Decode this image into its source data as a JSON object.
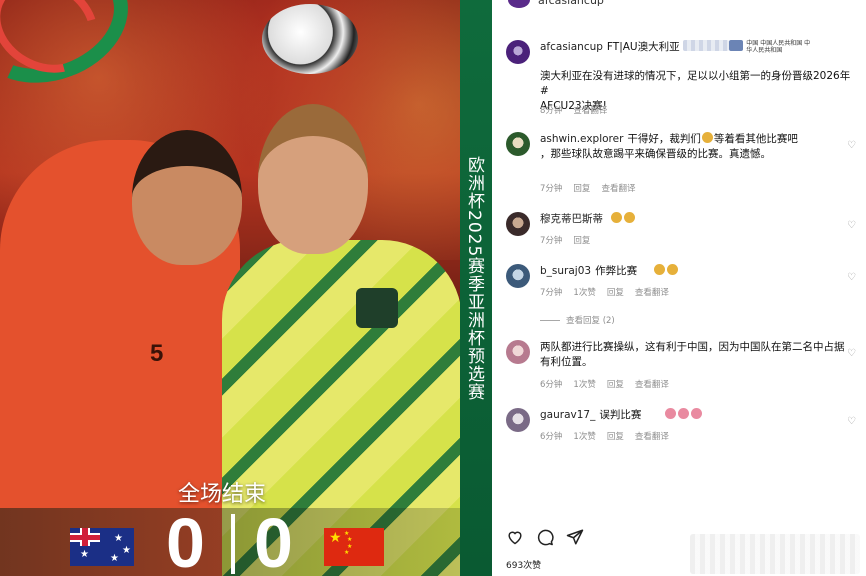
{
  "post_image": {
    "vertical_title": "欧洲杯2025赛季亚洲杯预选赛",
    "fulltime_label": "全场结束",
    "score_home": "0",
    "score_away": "0",
    "home_flag": "australia-flag",
    "away_flag": "china-flag",
    "jersey_number": "5"
  },
  "header": {
    "account": "afcasiancup"
  },
  "comments": [
    {
      "user": "afcasiancup",
      "text_line1": "FT|AU澳大利亚",
      "tag_text": "中国 中国人民共和国 中",
      "tag_text2": "华人民共和国",
      "text_line2": "澳大利亚在没有进球的情况下，足以以小组第一的身份晋级2026年#",
      "text_line3": "AFCU23决赛!",
      "time": "8分钟",
      "see_translation": "查看翻译"
    },
    {
      "user": "ashwin.explorer",
      "text_line1": "干得好，裁判们",
      "text_line1b": "等着看其他比赛吧",
      "text_line2": "，那些球队故意踢平来确保晋级的比赛。真遗憾。",
      "time": "7分钟",
      "reply": "回复",
      "see_translation": "查看翻译"
    },
    {
      "user": "穆克蒂巴斯蒂",
      "time": "7分钟",
      "reply": "回复"
    },
    {
      "user": "b_suraj03",
      "text_line1": "作弊比赛",
      "time": "7分钟",
      "likes": "1次赞",
      "reply": "回复",
      "see_translation": "查看翻译"
    },
    {
      "hidden_replies": "查看回复 (2)"
    },
    {
      "user": "",
      "text_line1": "两队都进行比赛操纵，这有利于中国，因为中国队在第二名中占据",
      "text_line2": "有利位置。",
      "time": "6分钟",
      "likes": "1次赞",
      "reply": "回复",
      "see_translation": "查看翻译"
    },
    {
      "user": "gaurav17_",
      "text_line1": "误判比赛",
      "time": "6分钟",
      "likes": "1次赞",
      "reply": "回复",
      "see_translation": "查看翻译"
    }
  ],
  "footer": {
    "likes_count": "693次赞",
    "icons": [
      "heart-icon",
      "comment-icon",
      "share-icon"
    ]
  },
  "colors": {
    "accent_green": "#0f6b3c",
    "china_red": "#de2910",
    "australia_blue": "#1b2f86",
    "muted_text": "#8e8e8e"
  }
}
